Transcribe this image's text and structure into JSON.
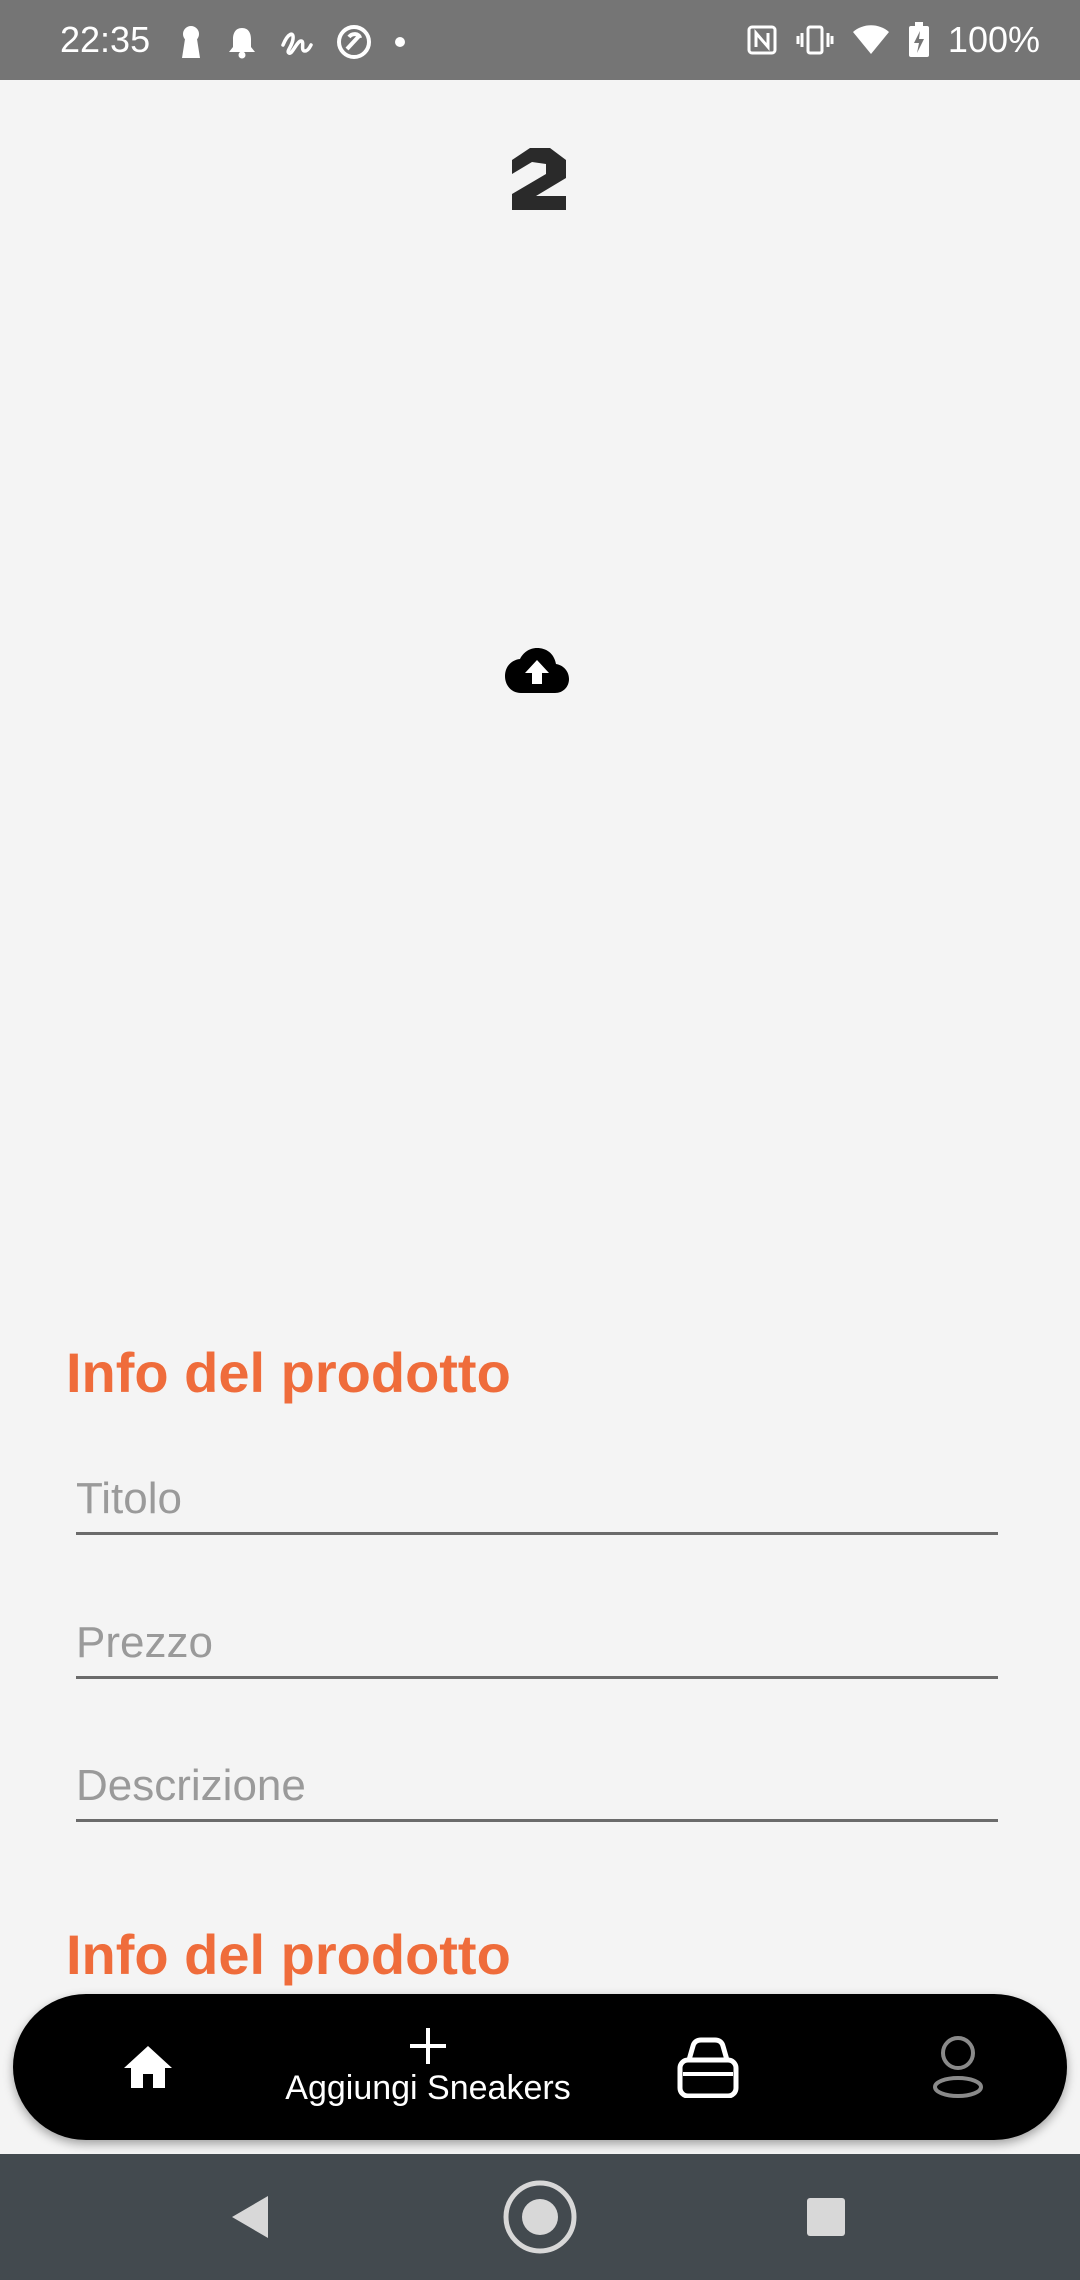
{
  "status_bar": {
    "time": "22:35",
    "battery": "100%",
    "left_icons": [
      "keyhole-icon",
      "bell-icon",
      "signature-icon",
      "at-icon",
      "dot-icon"
    ],
    "right_icons": [
      "nfc-icon",
      "vibrate-icon",
      "wifi-icon",
      "battery-charging-icon"
    ]
  },
  "header": {
    "logo": "brand-logo-icon"
  },
  "upload": {
    "icon": "cloud-upload-icon"
  },
  "sections": {
    "product_info_title": "Info del prodotto",
    "product_info_title_2": "Info del prodotto"
  },
  "form": {
    "title_placeholder": "Titolo",
    "title_value": "",
    "price_placeholder": "Prezzo",
    "price_value": "",
    "description_placeholder": "Descrizione",
    "description_value": ""
  },
  "bottom_nav": {
    "add_label": "Aggiungi Sneakers",
    "items": [
      "home-icon",
      "plus-icon",
      "shopping-bag-icon",
      "profile-icon"
    ]
  },
  "colors": {
    "accent": "#ef6c3b",
    "status_bar": "#757575",
    "background": "#f4f4f4",
    "nav_bar": "#000000",
    "system_nav": "#434a4f"
  }
}
